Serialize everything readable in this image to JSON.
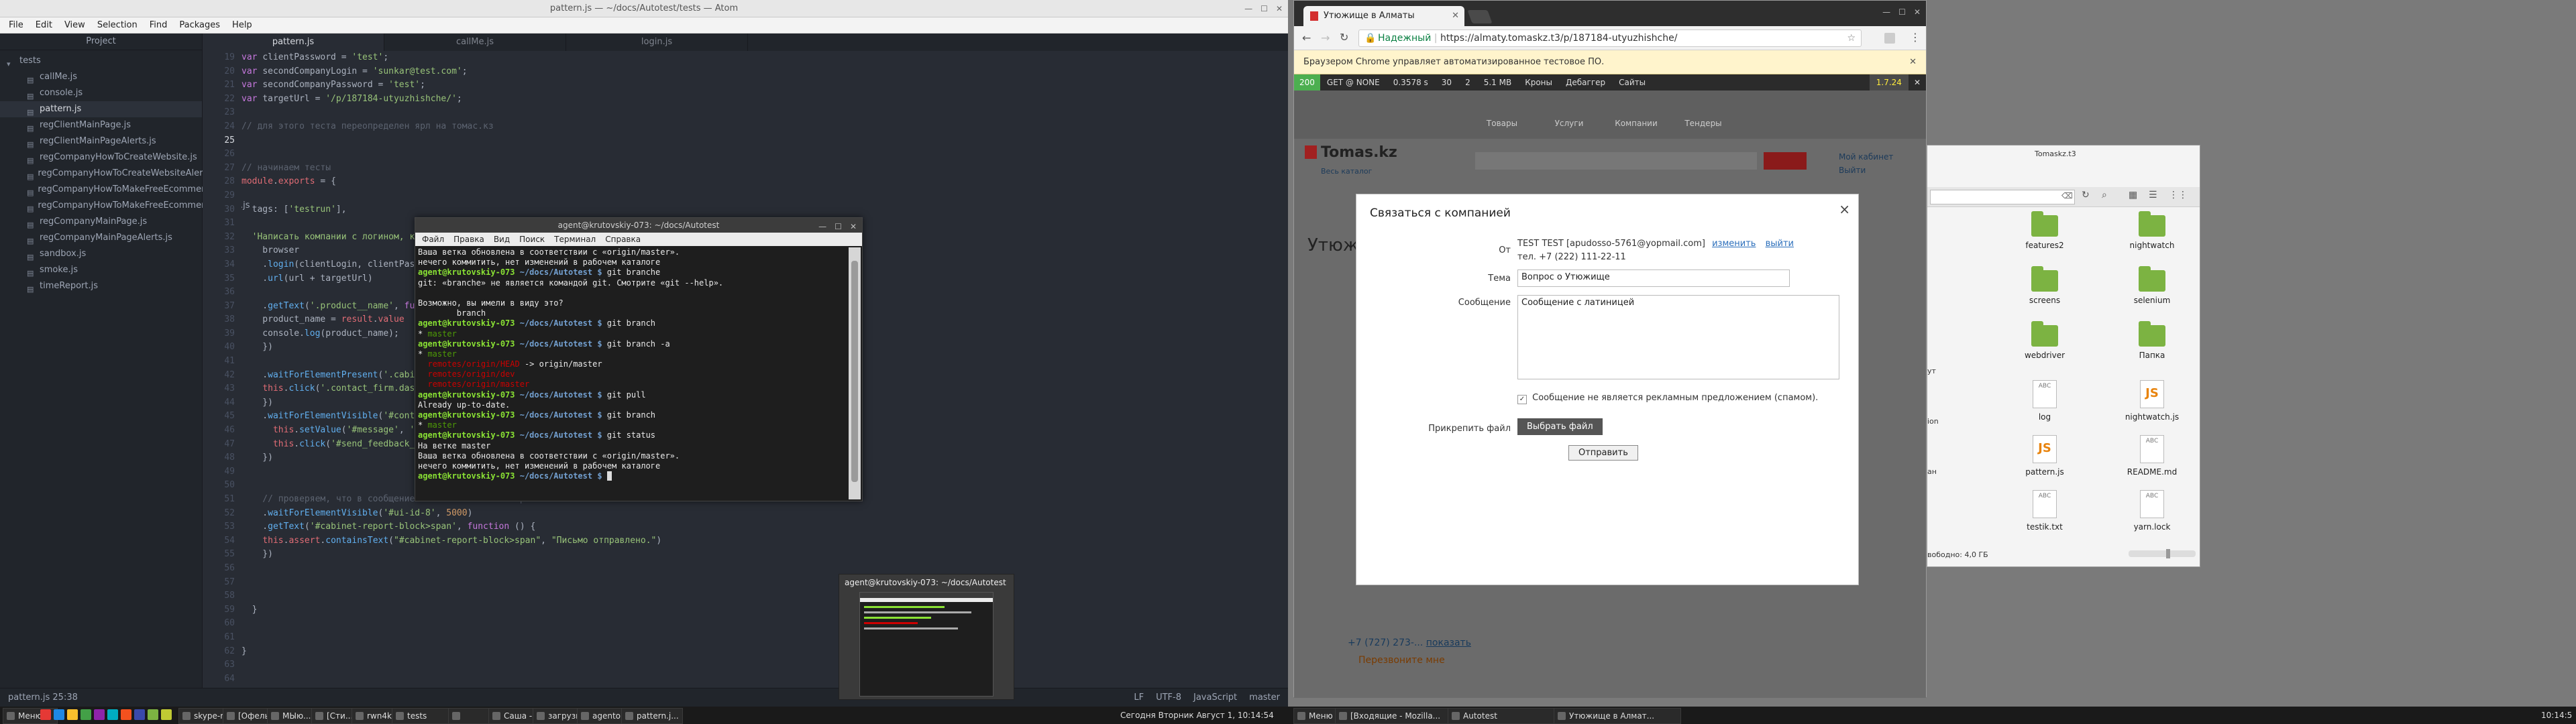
{
  "atom": {
    "title": "pattern.js — ~/docs/Autotest/tests — Atom",
    "menu": [
      "File",
      "Edit",
      "View",
      "Selection",
      "Find",
      "Packages",
      "Help"
    ],
    "project_title": "Project",
    "tree": [
      {
        "name": "tests",
        "kind": "folder"
      },
      {
        "name": "callMe.js",
        "kind": "file"
      },
      {
        "name": "console.js",
        "kind": "file"
      },
      {
        "name": "pattern.js",
        "kind": "file"
      },
      {
        "name": "regClientMainPage.js",
        "kind": "file"
      },
      {
        "name": "regClientMainPageAlerts.js",
        "kind": "file"
      },
      {
        "name": "regCompanyHowToCreateWebsite.js",
        "kind": "file"
      },
      {
        "name": "regCompanyHowToCreateWebsiteAlerts.js",
        "kind": "file"
      },
      {
        "name": "regCompanyHowToMakeFreeEcommerce.js",
        "kind": "file"
      },
      {
        "name": "regCompanyHowToMakeFreeEcommerceAlerts.js",
        "kind": "file"
      },
      {
        "name": "regCompanyMainPage.js",
        "kind": "file"
      },
      {
        "name": "regCompanyMainPageAlerts.js",
        "kind": "file"
      },
      {
        "name": "sandbox.js",
        "kind": "file"
      },
      {
        "name": "smoke.js",
        "kind": "file"
      },
      {
        "name": "timeReport.js",
        "kind": "file"
      }
    ],
    "tabs": [
      "pattern.js",
      "callMe.js",
      "login.js"
    ],
    "gutter": [
      "19",
      "20",
      "21",
      "22",
      "23",
      "24",
      "25",
      "26",
      "27",
      "28",
      "29",
      "30",
      "31",
      "32",
      "33",
      "34",
      "35",
      "36",
      "37",
      "38",
      "39",
      "40",
      "41",
      "42",
      "43",
      "44",
      "45",
      "46",
      "47",
      "48",
      "49",
      "50",
      "51",
      "52",
      "53",
      "54",
      "55",
      "56",
      "57",
      "58",
      "59",
      "60",
      "61",
      "62",
      "63",
      "64",
      "65",
      "66"
    ],
    "status_left": "pattern.js   25:38",
    "status_right": [
      "LF",
      "UTF-8",
      "JavaScript",
      "master"
    ]
  },
  "terminal": {
    "title": "agent@krutovskiy-073: ~/docs/Autotest",
    "menu": [
      "Файл",
      "Правка",
      "Вид",
      "Поиск",
      "Терминал",
      "Справка"
    ]
  },
  "thumbnail": {
    "title": "agent@krutovskiy-073: ~/docs/Autotest"
  },
  "chrome": {
    "tab_title": "Утюжище в Алматы",
    "url_secure": "Надежный",
    "url": "https://almaty.tomaskz.t3/p/187184-utyuzhishche/",
    "infobar": "Браузером Chrome управляет автоматизированное тестовое ПО.",
    "debug": [
      "200",
      "GET @ NONE",
      "0.3578 s",
      "30",
      "2",
      "5.1 MB",
      "Кроны",
      "Дебаггер",
      "Сайты",
      "1.7.24"
    ],
    "site": {
      "logo": "Tomas.kz",
      "nav": [
        "Товары",
        "Услуги",
        "Компании",
        "Тендеры"
      ],
      "cabinet": "Мой кабинет",
      "logout": "Выйти",
      "all_catalog": "Весь каталог",
      "phone": "+7 (727) 273-...",
      "show": "показать",
      "callback": "Перезвоните мне",
      "heading_partial": "Утюж"
    },
    "modal": {
      "title": "Связаться с компанией",
      "close": "×",
      "from_label": "От",
      "from_value": "TEST TEST [apudosso-5761@yopmail.com]",
      "change": "изменить",
      "logout": "выйти",
      "phone": "тел. +7 (222) 111-22-11",
      "subject_label": "Тема",
      "subject_value": "Вопрос о Утюжище",
      "message_label": "Сообщение",
      "message_value": "Сообщение с латиницей",
      "checkbox_label": "Сообщение не является рекламным предложением (спамом).",
      "attach_label": "Прикрепить файл",
      "choose_file": "Выбрать файл",
      "submit": "Отправить"
    }
  },
  "files": {
    "items": [
      {
        "name": "features2",
        "kind": "folder"
      },
      {
        "name": "nightwatch",
        "kind": "folder"
      },
      {
        "name": "screens",
        "kind": "folder"
      },
      {
        "name": "selenium",
        "kind": "folder"
      },
      {
        "name": "webdriver",
        "kind": "folder"
      },
      {
        "name": "Папка",
        "kind": "folder"
      },
      {
        "name": "log",
        "kind": "doc"
      },
      {
        "name": "nightwatch.js",
        "kind": "js"
      },
      {
        "name": "pattern.js",
        "kind": "js"
      },
      {
        "name": "README.md",
        "kind": "doc"
      },
      {
        "name": "testik.txt",
        "kind": "doc"
      },
      {
        "name": "yarn.lock",
        "kind": "doc"
      }
    ],
    "side_partial": [
      "ут",
      "ion",
      "ан"
    ],
    "tree_partial": [
      "Tomaskz.t3"
    ],
    "free": "вободно: 4,0 ГБ"
  },
  "taskbar": {
    "left": [
      {
        "label": "Меню",
        "width": 52
      },
      {
        "label": "skype-m...",
        "width": 62
      },
      {
        "label": "[Офель...",
        "width": 62
      },
      {
        "label": "МЫю...",
        "width": 62
      },
      {
        "label": "[Сти...]",
        "width": 56
      },
      {
        "label": "rwn4k",
        "width": 56
      },
      {
        "label": "tests",
        "width": 80
      },
      {
        "label": "",
        "width": 56
      },
      {
        "label": "Саша -...",
        "width": 62
      },
      {
        "label": "загрузки",
        "width": 62
      },
      {
        "label": "agentok...",
        "width": 62
      },
      {
        "label": "pattern.j...",
        "width": 62
      }
    ],
    "clock_left": "Сегодня Вторник Август 1, 10:14:54",
    "right_menu": "Меню",
    "right": [
      {
        "label": "[Входящие - Mozilla...",
        "width": 162
      },
      {
        "label": "Autotest",
        "width": 152
      },
      {
        "label": "Утюжище в Алмат...",
        "width": 160
      }
    ],
    "clock_right": "10:14:5"
  }
}
